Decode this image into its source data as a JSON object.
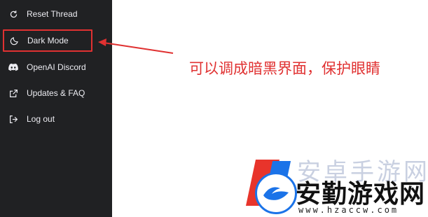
{
  "sidebar": {
    "items": [
      {
        "label": "Reset Thread",
        "icon": "refresh-icon"
      },
      {
        "label": "Dark Mode",
        "icon": "moon-icon"
      },
      {
        "label": "OpenAI Discord",
        "icon": "discord-icon"
      },
      {
        "label": "Updates & FAQ",
        "icon": "external-link-icon"
      },
      {
        "label": "Log out",
        "icon": "logout-icon"
      }
    ]
  },
  "annotation": {
    "text": "可以调成暗黑界面，保护眼睛",
    "color": "#e03131"
  },
  "watermark": {
    "faint_text": "安卓手游网",
    "title": "安勤游戏网",
    "url": "www.hzaccw.com"
  },
  "colors": {
    "sidebar_bg": "#202123",
    "sidebar_text": "#ececf1",
    "highlight": "#e03131"
  }
}
